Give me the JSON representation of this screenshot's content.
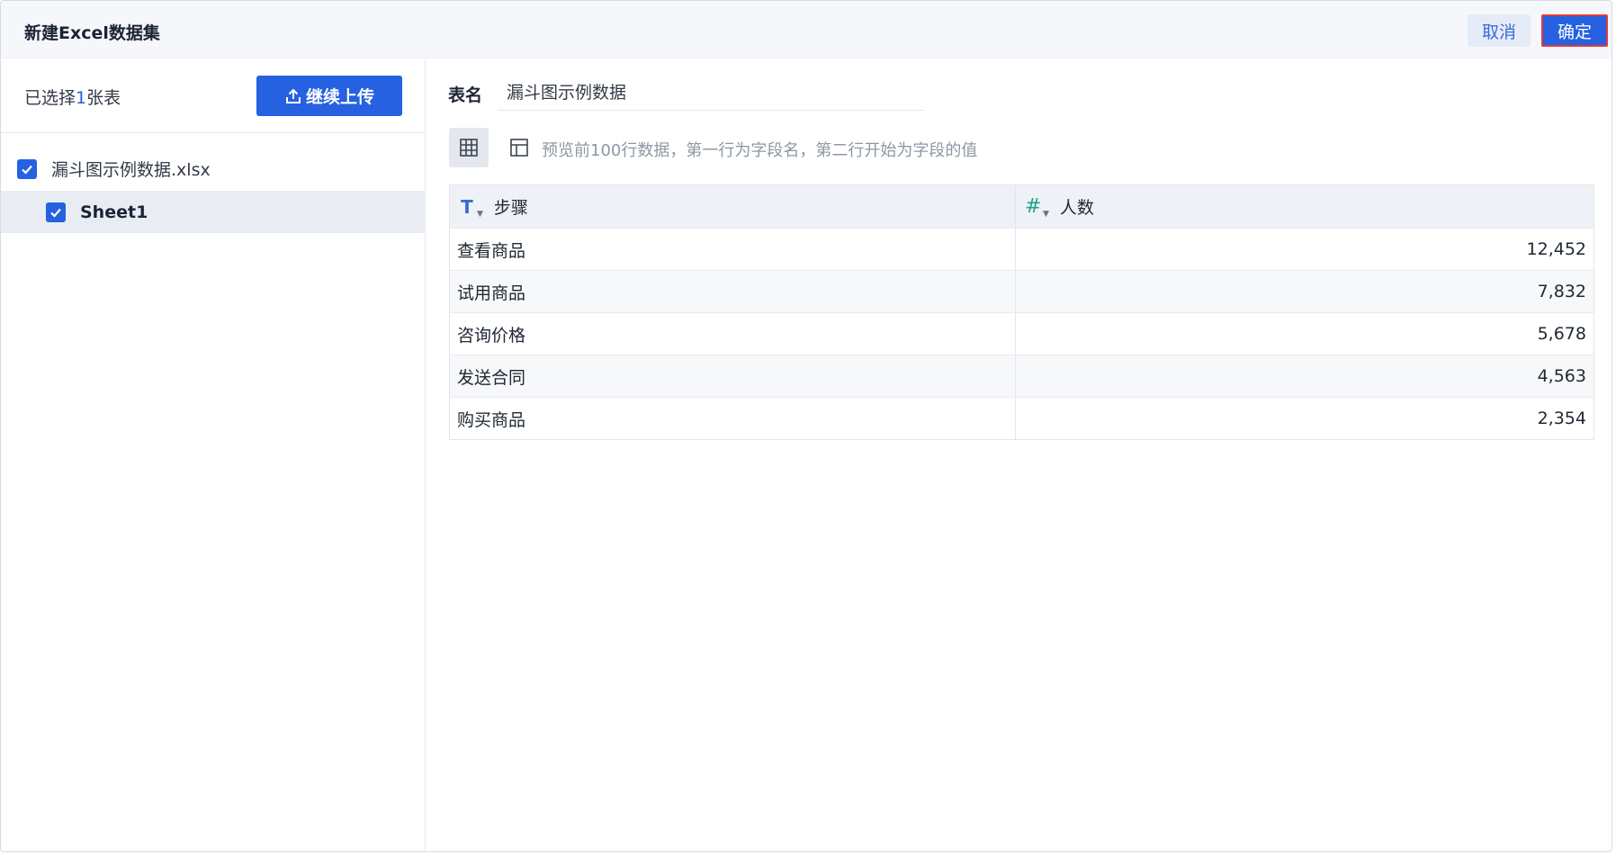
{
  "dialog": {
    "title": "新建Excel数据集",
    "cancel_label": "取消",
    "ok_label": "确定"
  },
  "left": {
    "selected_prefix": "已选择",
    "selected_count": "1",
    "selected_suffix": "张表",
    "upload_label": "继续上传",
    "upload_icon": "upload-icon",
    "file": {
      "name": "漏斗图示例数据.xlsx",
      "checked": true
    },
    "sheet": {
      "name": "Sheet1",
      "checked": true
    }
  },
  "right": {
    "table_name_label": "表名",
    "table_name_value": "漏斗图示例数据",
    "preview_hint": "预览前100行数据，第一行为字段名，第二行开始为字段的值",
    "columns": [
      {
        "type_icon": "T",
        "type": "text",
        "name": "步骤"
      },
      {
        "type_icon": "#",
        "type": "number",
        "name": "人数"
      }
    ],
    "rows": [
      {
        "step": "查看商品",
        "count": "12,452"
      },
      {
        "step": "试用商品",
        "count": "7,832"
      },
      {
        "step": "咨询价格",
        "count": "5,678"
      },
      {
        "step": "发送合同",
        "count": "4,563"
      },
      {
        "step": "购买商品",
        "count": "2,354"
      }
    ]
  },
  "colors": {
    "primary": "#2561e0",
    "highlight_border": "#e23a3a",
    "number_type": "#1fa38e"
  }
}
